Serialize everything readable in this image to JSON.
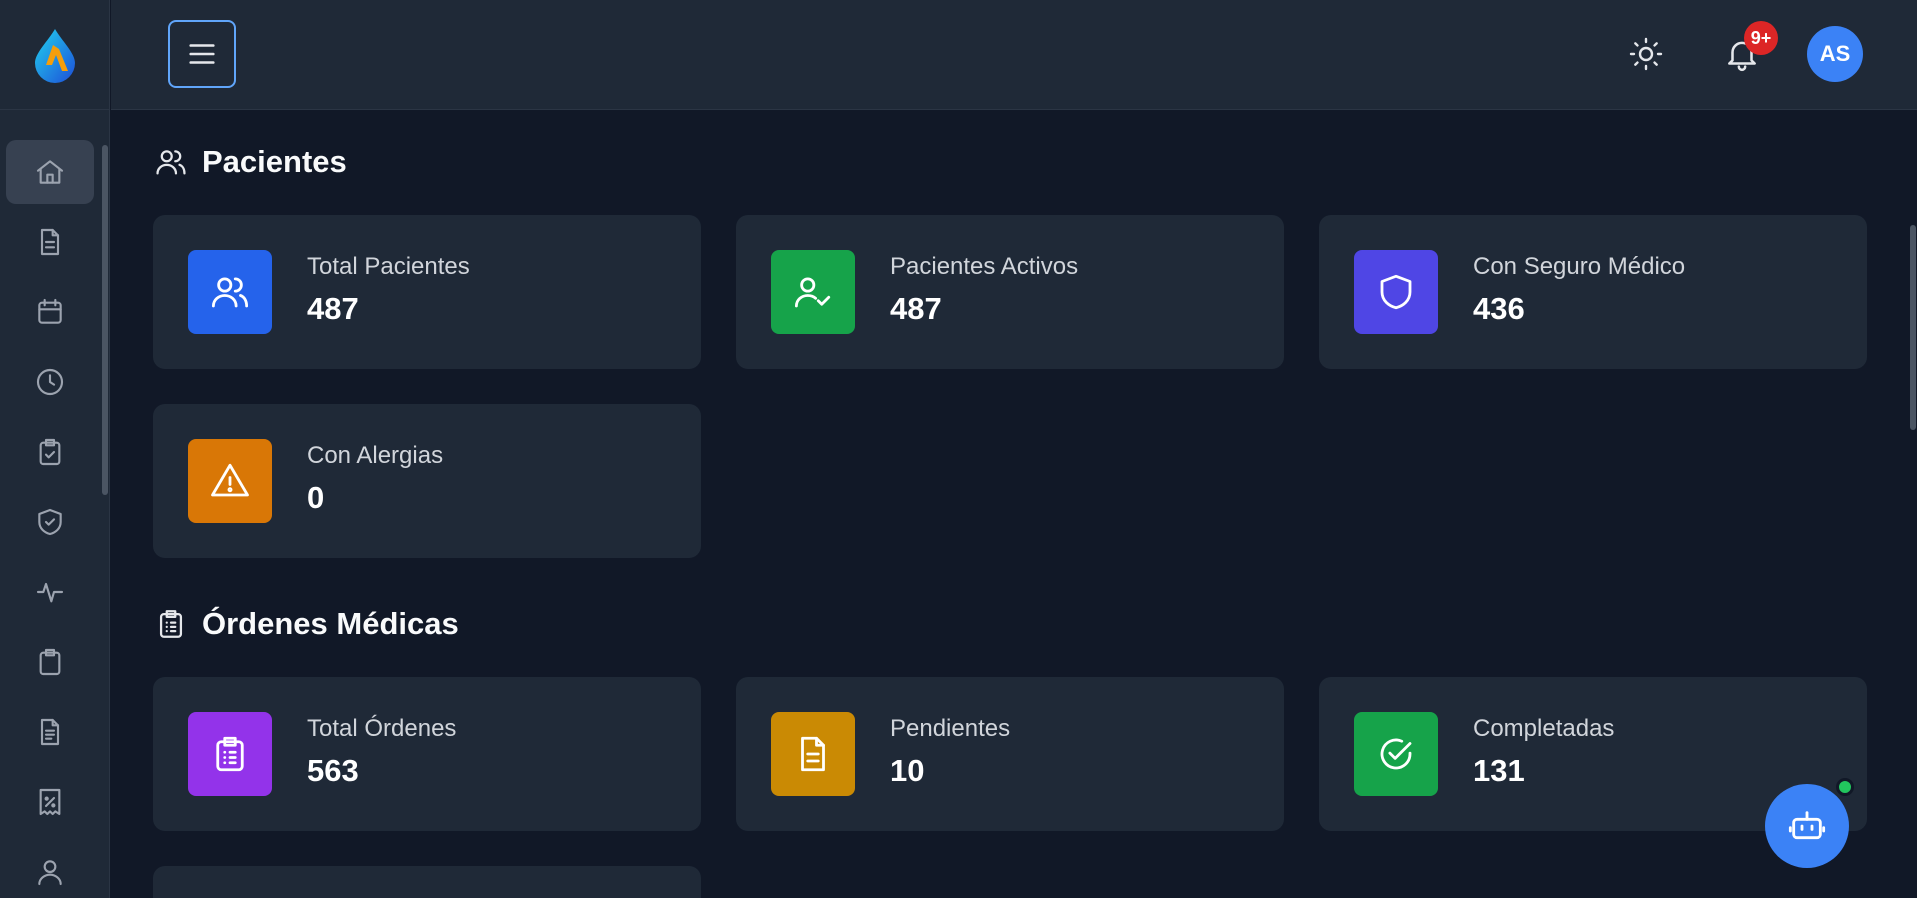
{
  "colors": {
    "blue": "#2563eb",
    "green": "#16a34a",
    "indigo": "#4f46e5",
    "orange": "#d97706",
    "purple": "#9333ea",
    "amber": "#ca8a04",
    "accent": "#3b82f6"
  },
  "header": {
    "notifications_badge": "9+",
    "avatar_initials": "AS",
    "theme_icon": "sun-icon",
    "bell_icon": "bell-icon",
    "menu_icon": "menu-icon"
  },
  "sidebar": {
    "items": [
      {
        "icon": "home-icon",
        "active": true
      },
      {
        "icon": "document-icon"
      },
      {
        "icon": "calendar-icon"
      },
      {
        "icon": "clock-icon"
      },
      {
        "icon": "clipboard-check-icon"
      },
      {
        "icon": "shield-check-icon"
      },
      {
        "icon": "activity-icon"
      },
      {
        "icon": "clipboard-icon"
      },
      {
        "icon": "file-text-icon"
      },
      {
        "icon": "receipt-percent-icon"
      },
      {
        "icon": "user-icon"
      }
    ]
  },
  "pacientes": {
    "title": "Pacientes",
    "cards": [
      {
        "label": "Total Pacientes",
        "value": "487",
        "icon": "users-icon"
      },
      {
        "label": "Pacientes Activos",
        "value": "487",
        "icon": "user-check-icon"
      },
      {
        "label": "Con Seguro Médico",
        "value": "436",
        "icon": "shield-icon"
      },
      {
        "label": "Con Alergias",
        "value": "0",
        "icon": "alert-triangle-icon"
      }
    ]
  },
  "ordenes": {
    "title": "Órdenes Médicas",
    "cards": [
      {
        "label": "Total Órdenes",
        "value": "563",
        "icon": "clipboard-list-icon"
      },
      {
        "label": "Pendientes",
        "value": "10",
        "icon": "document-lines-icon"
      },
      {
        "label": "Completadas",
        "value": "131",
        "icon": "check-circle-icon"
      }
    ]
  },
  "chatbot": {
    "icon": "bot-icon"
  }
}
